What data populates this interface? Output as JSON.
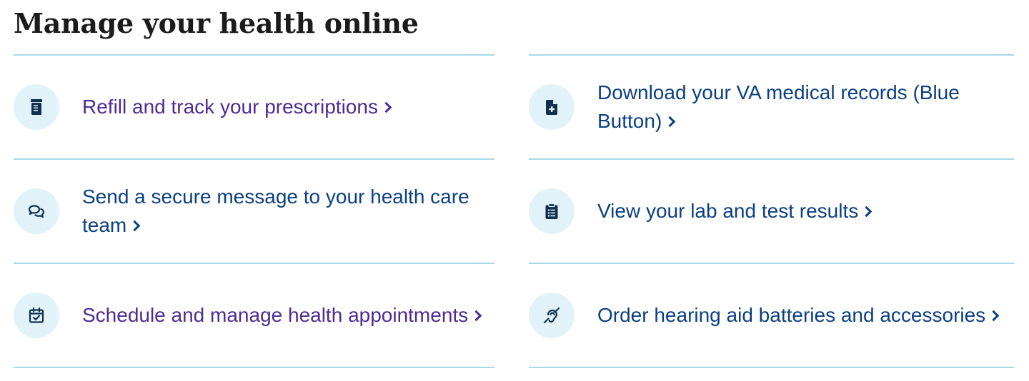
{
  "page": {
    "title": "Manage your health online"
  },
  "colors": {
    "visited_link": "#4c2c92",
    "link": "#0b3f80",
    "icon_bg": "#e1f3f8",
    "icon_fg": "#112f4e",
    "divider": "#a8d8ea"
  },
  "left_links": [
    {
      "label": "Refill and track your prescriptions",
      "icon": "prescription-bottle-icon"
    },
    {
      "label": "Send a secure message to your health care team",
      "icon": "chat-bubbles-icon"
    },
    {
      "label": "Schedule and manage health appointments",
      "icon": "calendar-check-icon"
    }
  ],
  "right_links": [
    {
      "label": "Download your VA medical records (Blue Button)",
      "icon": "medical-file-icon"
    },
    {
      "label": "View your lab and test results",
      "icon": "clipboard-list-icon"
    },
    {
      "label": "Order hearing aid batteries and accessories",
      "icon": "hearing-assist-icon"
    }
  ]
}
